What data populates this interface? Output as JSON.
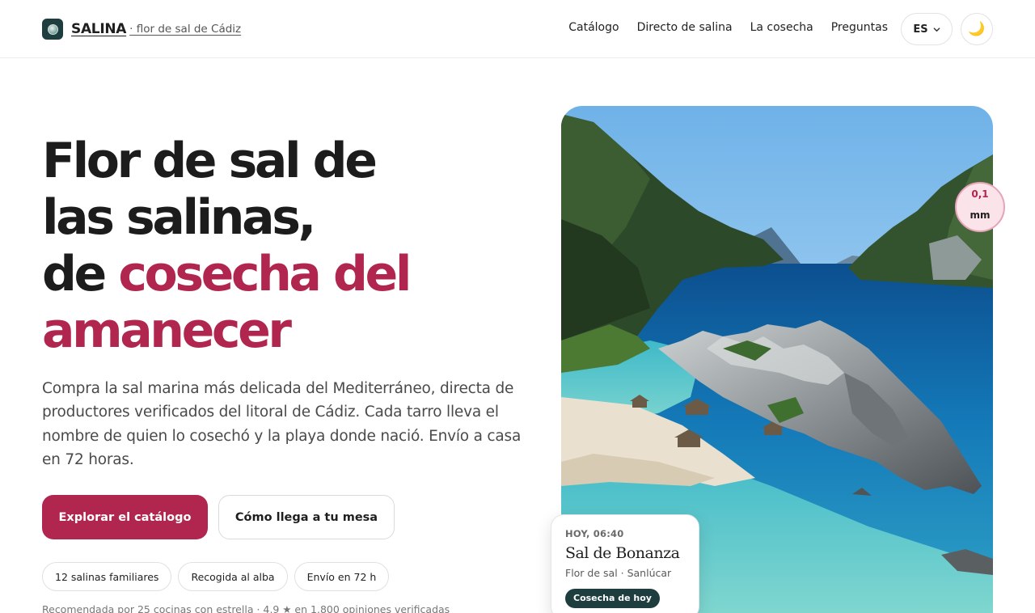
{
  "header": {
    "brand_name": "SALINA",
    "brand_tagline": "· flor de sal de Cádiz",
    "nav": [
      "Catálogo",
      "Directo de salina",
      "La cosecha",
      "Preguntas"
    ],
    "language": "ES",
    "theme_icon": "moon-icon"
  },
  "hero": {
    "title_line_1": "Flor de sal de",
    "title_line_2": "las salinas,",
    "title_line_3_plain": "de ",
    "title_line_3_accent": "cosecha del",
    "title_line_4_accent": "amanecer",
    "lead": "Compra la sal marina más delicada del Mediterráneo, directa de productores verificados del litoral de Cádiz. Cada tarro lleva el nombre de quien lo cosechó y la playa donde nació. Envío a casa en 72 horas.",
    "primary_cta": "Explorar el catálogo",
    "secondary_cta": "Cómo llega a tu mesa",
    "chips": [
      "12 salinas familiares",
      "Recogida al alba",
      "Envío en 72 h"
    ],
    "social_proof": "Recomendada por 25 cocinas con estrella · 4,9 ★ en 1.800 opiniones verificadas"
  },
  "photo_card": {
    "measure_value": "0,1",
    "measure_unit": "mm",
    "harvest_time": "HOY, 06:40",
    "harvest_name": "Sal de Bonanza",
    "harvest_meta": "Flor de sal · Sanlúcar",
    "harvest_badge": "Cosecha de hoy"
  },
  "colors": {
    "accent": "#b0264e",
    "dark_teal": "#1d3d3f"
  }
}
